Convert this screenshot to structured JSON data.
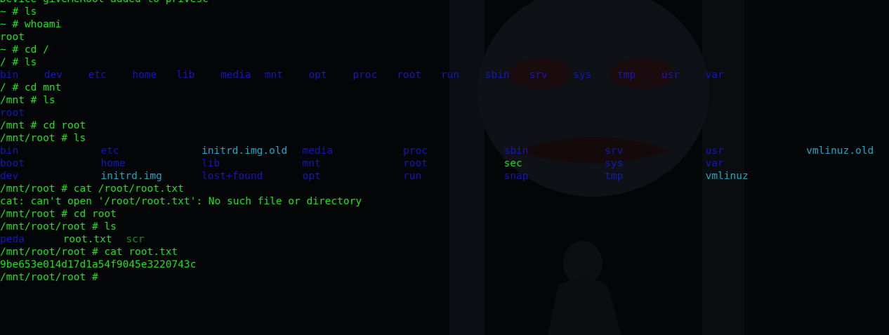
{
  "colors": {
    "background": "#030506",
    "prompt_text": "#19e619",
    "directory": "#1717b8",
    "symlink": "#1aa8c8",
    "executable": "#2ad42a",
    "file": "#19e619"
  },
  "terminal": {
    "lines": [
      {
        "segments": [
          {
            "text": "Device giveMeRoot added to privesc",
            "color": "green"
          }
        ]
      },
      {
        "segments": [
          {
            "text": "~ # ls",
            "color": "green"
          }
        ]
      },
      {
        "segments": [
          {
            "text": "~ # whoami",
            "color": "green"
          }
        ]
      },
      {
        "segments": [
          {
            "text": "root",
            "color": "green"
          }
        ]
      },
      {
        "segments": [
          {
            "text": "~ # cd /",
            "color": "green"
          }
        ]
      },
      {
        "segments": [
          {
            "text": "/ # ls",
            "color": "green"
          }
        ]
      },
      {
        "segments": [
          {
            "text": "bin",
            "color": "blue",
            "col": 0
          },
          {
            "text": "dev",
            "color": "blue",
            "col": 7
          },
          {
            "text": "etc",
            "color": "blue",
            "col": 14
          },
          {
            "text": "home",
            "color": "blue",
            "col": 21
          },
          {
            "text": "lib",
            "color": "blue",
            "col": 28
          },
          {
            "text": "media",
            "color": "blue",
            "col": 35
          },
          {
            "text": "mnt",
            "color": "blue",
            "col": 42
          },
          {
            "text": "opt",
            "color": "blue",
            "col": 49
          },
          {
            "text": "proc",
            "color": "blue",
            "col": 56
          },
          {
            "text": "root",
            "color": "blue",
            "col": 63
          },
          {
            "text": "run",
            "color": "blue",
            "col": 70
          },
          {
            "text": "sbin",
            "color": "blue",
            "col": 77
          },
          {
            "text": "srv",
            "color": "blue",
            "col": 84
          },
          {
            "text": "sys",
            "color": "blue",
            "col": 91
          },
          {
            "text": "tmp",
            "color": "blue",
            "col": 98
          },
          {
            "text": "usr",
            "color": "blue",
            "col": 105
          },
          {
            "text": "var",
            "color": "blue",
            "col": 112
          }
        ]
      },
      {
        "segments": [
          {
            "text": "/ # cd mnt",
            "color": "green"
          }
        ]
      },
      {
        "segments": [
          {
            "text": "/mnt # ls",
            "color": "green"
          }
        ]
      },
      {
        "segments": [
          {
            "text": "root",
            "color": "blue"
          }
        ]
      },
      {
        "segments": [
          {
            "text": "/mnt # cd root",
            "color": "green"
          }
        ]
      },
      {
        "segments": [
          {
            "text": "/mnt/root # ls",
            "color": "green"
          }
        ]
      },
      {
        "segments": [
          {
            "text": "bin",
            "color": "blue",
            "col": 0
          },
          {
            "text": "etc",
            "color": "blue",
            "col": 16
          },
          {
            "text": "initrd.img.old",
            "color": "cyan",
            "col": 32
          },
          {
            "text": "media",
            "color": "blue",
            "col": 48
          },
          {
            "text": "proc",
            "color": "blue",
            "col": 64
          },
          {
            "text": "sbin",
            "color": "blue",
            "col": 80
          },
          {
            "text": "srv",
            "color": "blue",
            "col": 96
          },
          {
            "text": "usr",
            "color": "blue",
            "col": 112
          },
          {
            "text": "vmlinuz.old",
            "color": "cyan",
            "col": 128
          }
        ]
      },
      {
        "segments": [
          {
            "text": "boot",
            "color": "blue",
            "col": 0
          },
          {
            "text": "home",
            "color": "blue",
            "col": 16
          },
          {
            "text": "lib",
            "color": "blue",
            "col": 32
          },
          {
            "text": "mnt",
            "color": "blue",
            "col": 48
          },
          {
            "text": "root",
            "color": "blue",
            "col": 64
          },
          {
            "text": "sec",
            "color": "lime",
            "col": 80
          },
          {
            "text": "sys",
            "color": "blue",
            "col": 96
          },
          {
            "text": "var",
            "color": "blue",
            "col": 112
          }
        ]
      },
      {
        "segments": [
          {
            "text": "dev",
            "color": "blue",
            "col": 0
          },
          {
            "text": "initrd.img",
            "color": "cyan",
            "col": 16
          },
          {
            "text": "lost+found",
            "color": "blue",
            "col": 32
          },
          {
            "text": "opt",
            "color": "blue",
            "col": 48
          },
          {
            "text": "run",
            "color": "blue",
            "col": 64
          },
          {
            "text": "snap",
            "color": "blue",
            "col": 80
          },
          {
            "text": "tmp",
            "color": "blue",
            "col": 96
          },
          {
            "text": "vmlinuz",
            "color": "cyan",
            "col": 112
          }
        ]
      },
      {
        "segments": [
          {
            "text": "/mnt/root # cat /root/root.txt",
            "color": "green"
          }
        ]
      },
      {
        "segments": [
          {
            "text": "cat: can't open '/root/root.txt': No such file or directory",
            "color": "green"
          }
        ]
      },
      {
        "segments": [
          {
            "text": "/mnt/root # cd root",
            "color": "green"
          }
        ]
      },
      {
        "segments": [
          {
            "text": "/mnt/root/root # ls",
            "color": "green"
          }
        ]
      },
      {
        "segments": [
          {
            "text": "peda",
            "color": "blue",
            "col": 0
          },
          {
            "text": "root.txt",
            "color": "green",
            "col": 10
          },
          {
            "text": "scr",
            "color": "dgreen",
            "col": 20
          }
        ]
      },
      {
        "segments": [
          {
            "text": "/mnt/root/root # cat root.txt",
            "color": "green"
          }
        ]
      },
      {
        "segments": [
          {
            "text": "9be653e014d17d1a54f9045e3220743c",
            "color": "green"
          }
        ]
      },
      {
        "segments": [
          {
            "text": "/mnt/root/root # ",
            "color": "green"
          }
        ]
      }
    ]
  }
}
